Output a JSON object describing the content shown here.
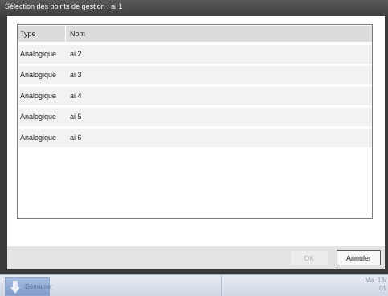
{
  "dialog": {
    "title": "Sélection des points de gestion : ai 1"
  },
  "list": {
    "columns": {
      "type": "Type",
      "name": "Nom"
    },
    "rows": [
      {
        "type": "Analogique",
        "name": "ai 2"
      },
      {
        "type": "Analogique",
        "name": "ai 3"
      },
      {
        "type": "Analogique",
        "name": "ai 4"
      },
      {
        "type": "Analogique",
        "name": "ai 5"
      },
      {
        "type": "Analogique",
        "name": "ai 6"
      }
    ]
  },
  "buttons": {
    "ok": "OK",
    "cancel": "Annuler"
  },
  "taskbar": {
    "start_label": "Démarrer",
    "clock_line1": "Ma. 13/",
    "clock_line2": "01"
  },
  "colors": {
    "title_bg": "#3f3f3f",
    "header_bg": "#dcdcdc",
    "row_bg": "#f2f2f2",
    "taskbar_bg": "#dbe1ec"
  },
  "icons": {
    "start": "down-arrow-icon"
  }
}
